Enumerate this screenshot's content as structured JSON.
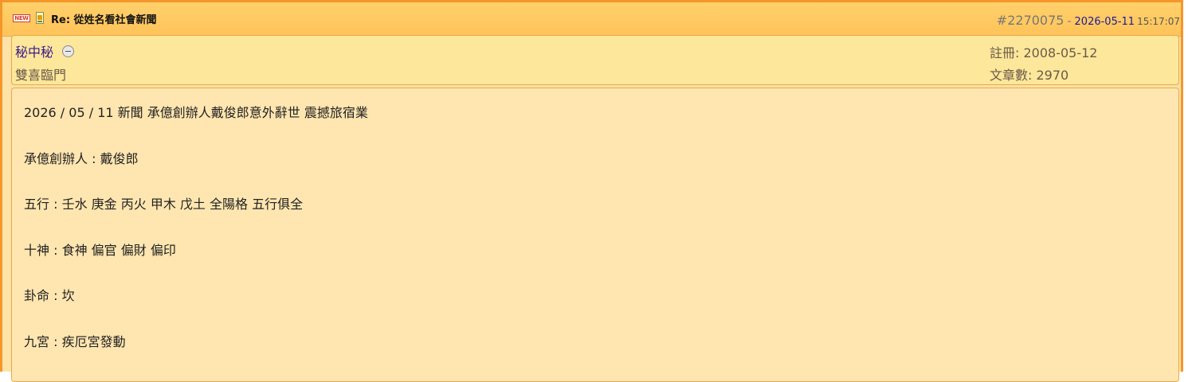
{
  "post": {
    "title": "Re: 從姓名看社會新聞",
    "new_badge": "NEW",
    "post_number": "#2270075",
    "separator": "-",
    "date": "2026-05-11",
    "time": "15:17:07"
  },
  "user": {
    "name": "秘中秘",
    "user_title": "雙喜臨門",
    "registered": "註冊: 2008-05-12",
    "post_count": "文章數: 2970"
  },
  "content": {
    "lines": [
      "2026 / 05 / 11 新聞 承億創辦人戴俊郎意外辭世 震撼旅宿業",
      "承億創辦人 : 戴俊郎",
      "五行 : 壬水 庚金 丙火 甲木 戊土 全陽格 五行俱全",
      "十神 : 食神 偏官 偏財 偏印",
      "卦命 : 坎",
      "九宮 : 疾厄宮發動"
    ]
  },
  "colors": {
    "border": "#f5962a",
    "titlebar": "#ffc35a",
    "userbox": "#fde79a",
    "content": "#ffe6b0",
    "date": "#1a1a9a",
    "username": "#3a1a8a"
  },
  "icons": [
    "new-badge-icon",
    "document-icon",
    "offline-status-icon"
  ]
}
